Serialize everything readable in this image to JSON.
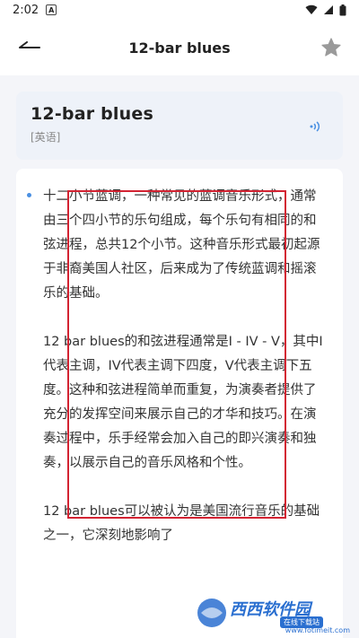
{
  "status_bar": {
    "time": "2:02",
    "notification_glyph": "A"
  },
  "app_bar": {
    "title": "12-bar blues",
    "back_icon": "back-arrow-icon",
    "favorite_icon": "star-icon"
  },
  "header_card": {
    "word": "12-bar blues",
    "language": "[英语]",
    "audio_icon": "speaker-icon"
  },
  "content": {
    "paragraphs": [
      "十二小节蓝调，一种常见的蓝调音乐形式，通常由三个四小节的乐句组成，每个乐句有相同的和弦进程，总共12个小节。这种音乐形式最初起源于非裔美国人社区，后来成为了传统蓝调和摇滚乐的基础。",
      "12 bar blues的和弦进程通常是I - IV - V，其中I代表主调，IV代表主调下四度，V代表主调下五度。这种和弦进程简单而重复，为演奏者提供了充分的发挥空间来展示自己的才华和技巧。在演奏过程中，乐手经常会加入自己的即兴演奏和独奏，以展示自己的音乐风格和个性。",
      "12 bar blues可以被认为是美国流行音乐的基础之一，它深刻地影响了"
    ]
  },
  "watermark": {
    "brand": "西西软件园",
    "sub": "在线下载站",
    "url": "www.fotimeit.com"
  },
  "colors": {
    "highlight_box": "#d32332",
    "accent": "#4a90e2"
  }
}
